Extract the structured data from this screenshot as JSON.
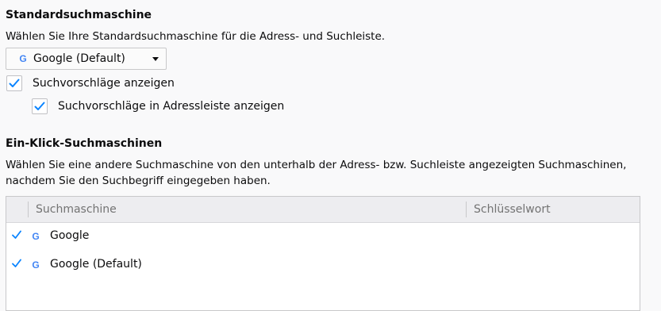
{
  "default_engine": {
    "heading": "Standardsuchmaschine",
    "description": "Wählen Sie Ihre Standardsuchmaschine für die Adress- und Suchleiste.",
    "dropdown": {
      "selected": "Google (Default)",
      "icon": "google-g-icon"
    },
    "suggestions_checkbox": {
      "label": "Suchvorschläge anzeigen",
      "checked": true
    },
    "addressbar_suggestions_checkbox": {
      "label": "Suchvorschläge in Adressleiste anzeigen",
      "checked": true
    }
  },
  "one_click": {
    "heading": "Ein-Klick-Suchmaschinen",
    "description_line1": "Wählen Sie eine andere Suchmaschine von den unterhalb der Adress- bzw. Suchleiste angezeigten Suchmaschinen,",
    "description_line2": "nachdem Sie den Suchbegriff eingegeben haben.",
    "table": {
      "columns": [
        "Suchmaschine",
        "Schlüsselwort"
      ],
      "rows": [
        {
          "checked": true,
          "icon": "google-g-icon",
          "name": "Google",
          "keyword": ""
        },
        {
          "checked": true,
          "icon": "google-g-icon",
          "name": "Google (Default)",
          "keyword": ""
        }
      ]
    }
  },
  "colors": {
    "accent": "#0a84ff",
    "page_bg": "#f9f9fa",
    "header_bg": "#ededf0"
  }
}
